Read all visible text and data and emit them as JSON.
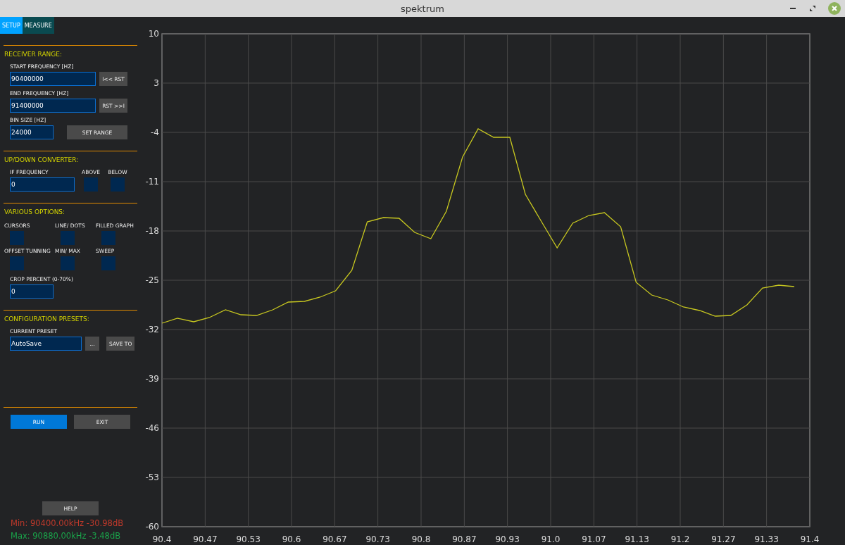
{
  "window": {
    "title": "spektrum"
  },
  "tabs": [
    {
      "label": "SETUP",
      "selected": true
    },
    {
      "label": "MEASURE",
      "selected": false
    }
  ],
  "receiver_range": {
    "heading": "RECEIVER RANGE:",
    "fields": [
      {
        "label": "START FREQUENCY [HZ]",
        "value": "90400000",
        "button": "I<< RST"
      },
      {
        "label": "END FREQUENCY [HZ]",
        "value": "91400000",
        "button": "RST >>I"
      }
    ],
    "bin_size": {
      "label": "BIN SIZE [HZ]",
      "value": "24000",
      "button": "SET RANGE"
    }
  },
  "converter": {
    "heading": "UP/DOWN CONVERTER:",
    "if_frequency": {
      "label": "IF FREQUENCY",
      "value": "0"
    },
    "options": [
      {
        "label": "ABOVE",
        "checked": false
      },
      {
        "label": "BELOW",
        "checked": false
      }
    ]
  },
  "various_options": {
    "heading": "VARIOUS OPTIONS:",
    "toggles": [
      {
        "label": "CURSORS",
        "checked": false
      },
      {
        "label": "LINE/ DOTS",
        "checked": false
      },
      {
        "label": "FILLED GRAPH",
        "checked": false
      },
      {
        "label": "OFFSET TUNNING",
        "checked": false
      },
      {
        "label": "MIN/ MAX",
        "checked": false
      },
      {
        "label": "SWEEP",
        "checked": false
      }
    ],
    "crop_percent": {
      "label": "CROP PERCENT (0-70%)",
      "value": "0"
    }
  },
  "presets": {
    "heading": "CONFIGURATION PRESETS:",
    "current_preset": {
      "label": "CURRENT PRESET",
      "value": "AutoSave"
    },
    "browse_button": "...",
    "save_button": "SAVE TO"
  },
  "actions": [
    {
      "label": "RUN",
      "kind": "primary"
    },
    {
      "label": "EXIT",
      "kind": "secondary"
    }
  ],
  "help_button": "HELP",
  "readouts": [
    {
      "text": "Min: 90400.00kHz -30.98dB",
      "color": "#c0392b"
    },
    {
      "text": "Max: 90880.00kHz -3.48dB",
      "color": "#1aa34a"
    }
  ],
  "spectrum": {
    "chart_data": {
      "type": "line",
      "xlim": [
        90.4,
        91.4
      ],
      "ylim": [
        -60,
        10
      ],
      "xticks": [
        {
          "value": 90.4,
          "label": "90.4"
        },
        {
          "value": 90.4667,
          "label": "90.47"
        },
        {
          "value": 90.5333,
          "label": "90.53"
        },
        {
          "value": 90.6,
          "label": "90.6"
        },
        {
          "value": 90.6667,
          "label": "90.67"
        },
        {
          "value": 90.7333,
          "label": "90.73"
        },
        {
          "value": 90.8,
          "label": "90.8"
        },
        {
          "value": 90.8667,
          "label": "90.87"
        },
        {
          "value": 90.9333,
          "label": "90.93"
        },
        {
          "value": 91.0,
          "label": "91.0"
        },
        {
          "value": 91.0667,
          "label": "91.07"
        },
        {
          "value": 91.1333,
          "label": "91.13"
        },
        {
          "value": 91.2,
          "label": "91.2"
        },
        {
          "value": 91.2667,
          "label": "91.27"
        },
        {
          "value": 91.3333,
          "label": "91.33"
        },
        {
          "value": 91.4,
          "label": "91.4"
        }
      ],
      "yticks": [
        10,
        3,
        -4,
        -11,
        -18,
        -25,
        -32,
        -39,
        -46,
        -53,
        -60
      ],
      "x": [
        90.4,
        90.424,
        90.449,
        90.473,
        90.498,
        90.522,
        90.546,
        90.571,
        90.595,
        90.62,
        90.644,
        90.668,
        90.693,
        90.717,
        90.742,
        90.766,
        90.79,
        90.815,
        90.839,
        90.864,
        90.888,
        90.912,
        90.937,
        90.961,
        90.986,
        91.01,
        91.034,
        91.059,
        91.083,
        91.108,
        91.132,
        91.156,
        91.181,
        91.205,
        91.23,
        91.254,
        91.278,
        91.303,
        91.327,
        91.352,
        91.376
      ],
      "grid": true,
      "series": [
        {
          "color": "#c8c820",
          "values": [
            -31.1,
            -30.4,
            -30.9,
            -30.3,
            -29.2,
            -29.9,
            -30.0,
            -29.2,
            -28.1,
            -28.0,
            -27.4,
            -26.5,
            -23.6,
            -16.7,
            -16.1,
            -16.2,
            -18.2,
            -19.1,
            -15.2,
            -7.5,
            -3.5,
            -4.7,
            -4.7,
            -12.8,
            -16.7,
            -20.4,
            -16.9,
            -15.8,
            -15.4,
            -17.4,
            -25.3,
            -27.1,
            -27.8,
            -28.8,
            -29.3,
            -30.1,
            -30.0,
            -28.5,
            -26.1,
            -25.7,
            -25.9
          ]
        }
      ]
    }
  }
}
